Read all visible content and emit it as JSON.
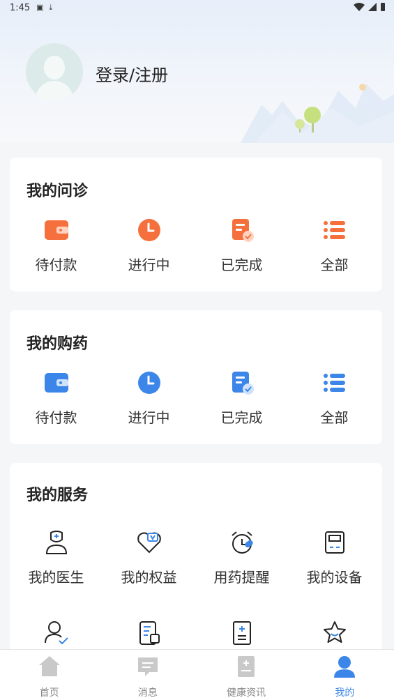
{
  "status_bar": {
    "time": "1:45"
  },
  "profile": {
    "login_label": "登录/注册"
  },
  "consultation": {
    "title": "我的问诊",
    "items": [
      {
        "label": "待付款",
        "icon": "wallet-icon"
      },
      {
        "label": "进行中",
        "icon": "clock-icon"
      },
      {
        "label": "已完成",
        "icon": "checklist-icon"
      },
      {
        "label": "全部",
        "icon": "list-icon"
      }
    ],
    "accent": "#f5703c"
  },
  "medicine": {
    "title": "我的购药",
    "items": [
      {
        "label": "待付款",
        "icon": "wallet-icon"
      },
      {
        "label": "进行中",
        "icon": "clock-icon"
      },
      {
        "label": "已完成",
        "icon": "checklist-icon"
      },
      {
        "label": "全部",
        "icon": "list-icon"
      }
    ],
    "accent": "#3b86e8"
  },
  "services": {
    "title": "我的服务",
    "items": [
      {
        "label": "我的医生",
        "icon": "doctor-icon"
      },
      {
        "label": "我的权益",
        "icon": "heart-badge-icon"
      },
      {
        "label": "用药提醒",
        "icon": "alarm-icon"
      },
      {
        "label": "我的设备",
        "icon": "device-icon"
      },
      {
        "label": "",
        "icon": "user-check-icon"
      },
      {
        "label": "",
        "icon": "records-icon"
      },
      {
        "label": "",
        "icon": "medical-book-icon"
      },
      {
        "label": "",
        "icon": "star-icon"
      }
    ]
  },
  "tabbar": {
    "tabs": [
      {
        "label": "首页",
        "icon": "home-icon"
      },
      {
        "label": "消息",
        "icon": "message-icon"
      },
      {
        "label": "健康资讯",
        "icon": "news-icon"
      },
      {
        "label": "我的",
        "icon": "profile-icon",
        "active": true
      }
    ],
    "active_color": "#3b86e8"
  }
}
